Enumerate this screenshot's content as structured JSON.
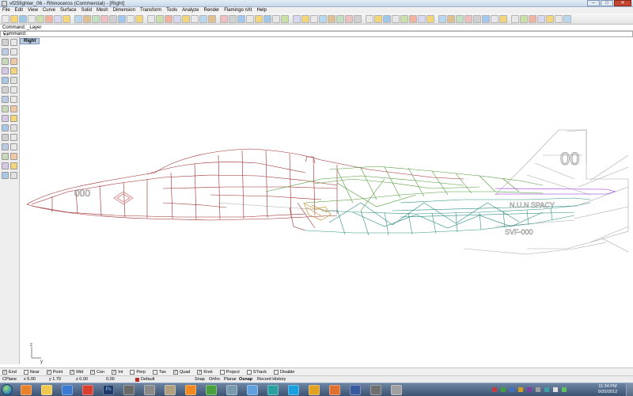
{
  "window": {
    "title": "vf25fighter_06 - Rhinoceros (Commercial) - [Right]",
    "buttons": {
      "minimize": "–",
      "maximize": "□",
      "close": "✕"
    }
  },
  "menu": [
    "File",
    "Edit",
    "View",
    "Curve",
    "Surface",
    "Solid",
    "Mesh",
    "Dimension",
    "Transform",
    "Tools",
    "Analyze",
    "Render",
    "Flamingo nXt",
    "Help"
  ],
  "command": {
    "history": "Command: _Layer",
    "prompt": "Command:",
    "dropdown_icon": "▾ ▸"
  },
  "viewport": {
    "tab_label": "Right",
    "axis_z": "z",
    "axis_y": "y",
    "decals": {
      "tail_number": "00",
      "nose_number": "000",
      "side_text": "N.U.N SPACY",
      "serial": "SVF-000"
    }
  },
  "osnaps": [
    {
      "label": "End",
      "checked": true
    },
    {
      "label": "Near",
      "checked": false
    },
    {
      "label": "Point",
      "checked": true
    },
    {
      "label": "Mid",
      "checked": true
    },
    {
      "label": "Cen",
      "checked": true
    },
    {
      "label": "Int",
      "checked": true
    },
    {
      "label": "Perp",
      "checked": false
    },
    {
      "label": "Tan",
      "checked": false
    },
    {
      "label": "Quad",
      "checked": true
    },
    {
      "label": "Knot",
      "checked": true
    },
    {
      "label": "Project",
      "checked": false
    },
    {
      "label": "STrack",
      "checked": false
    },
    {
      "label": "Disable",
      "checked": false
    }
  ],
  "status": {
    "cplane": "CPlane",
    "x": "x 5.00",
    "y": "y 1.70",
    "z": "z 0.00",
    "extra": "0.00",
    "layer": "Default",
    "snap": "Snap",
    "ortho": "Ortho",
    "planar": "Planar",
    "osnap": "Osnap",
    "record_history": "Record History"
  },
  "taskbar": {
    "time": "11:34 PM",
    "date": "9/20/2012",
    "ps_label": "Ps"
  },
  "colors": {
    "fuselage_wire": "#9b2a2a",
    "intake_wire": "#4e9a36",
    "engine_wire": "#2f8f86",
    "accent_wire": "#c49530",
    "background_grey": "#9c9c9c",
    "missile_wire": "#b065e0",
    "nose_marking": "#d88080",
    "viewport_tab": "#b9cce2",
    "taskbar": "#3c5372"
  }
}
